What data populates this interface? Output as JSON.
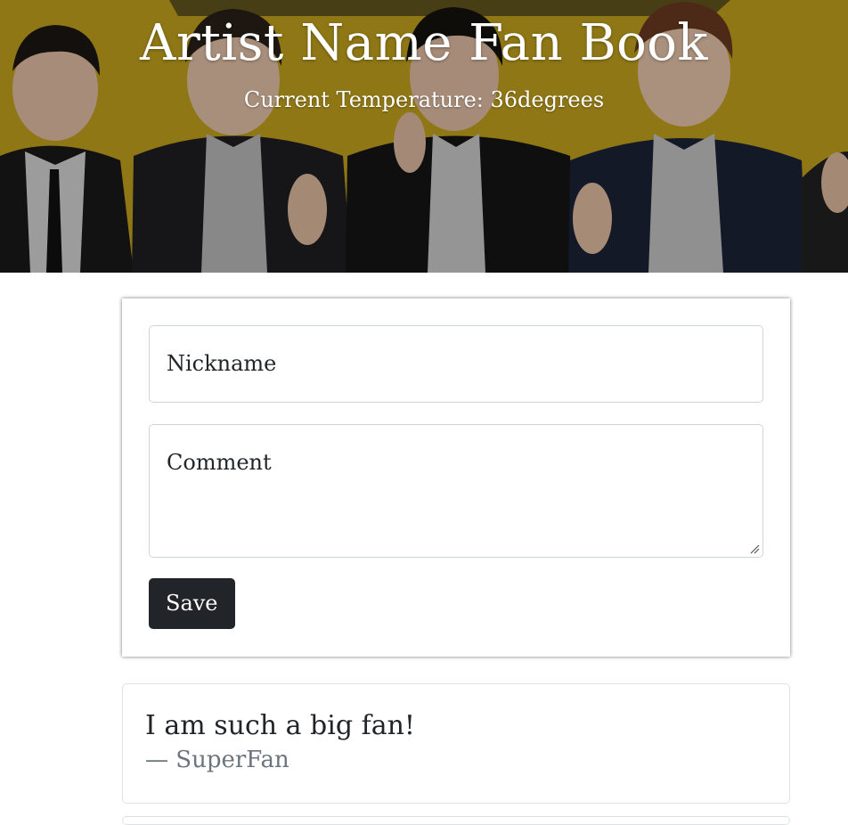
{
  "header": {
    "title": "Artist Name Fan Book",
    "temperature_text": "Current Temperature: 36degrees",
    "accent_color": "#c9a823"
  },
  "form": {
    "nickname_label": "Nickname",
    "comment_label": "Comment",
    "save_label": "Save"
  },
  "comments": [
    {
      "text": "I am such a big fan!",
      "author": "— SuperFan"
    }
  ]
}
